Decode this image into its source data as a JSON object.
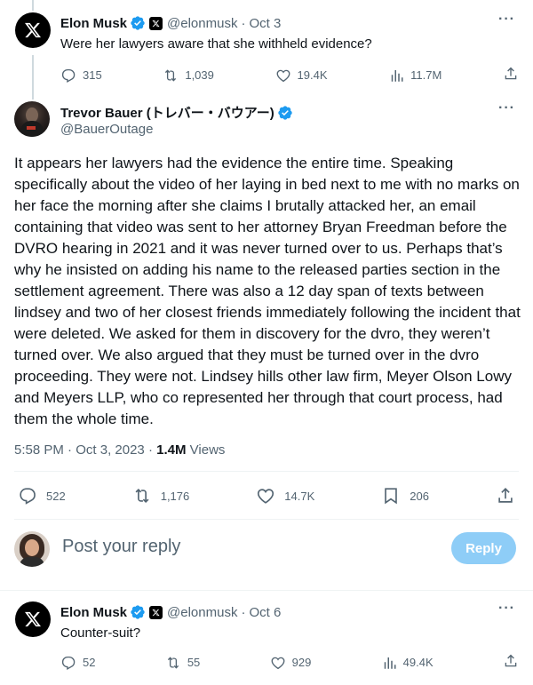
{
  "top_tweet": {
    "name": "Elon Musk",
    "handle": "@elonmusk",
    "date": "Oct 3",
    "text": "Were her lawyers aware that she withheld evidence?",
    "more_icon": "more-icon",
    "actions": {
      "replies": "315",
      "reposts": "1,039",
      "likes": "19.4K",
      "views": "11.7M"
    }
  },
  "main_tweet": {
    "name": "Trevor Bauer (トレバー・バウアー)",
    "handle": "@BauerOutage",
    "text": "It appears her lawyers had the evidence the entire time. Speaking specifically about the video of her laying in bed next to me with no marks on her face the morning after she claims I brutally attacked her, an email containing that video was sent to her attorney Bryan Freedman before the DVRO hearing in 2021 and it was never turned over to us. Perhaps that’s why he insisted on adding his name to the released parties section in the settlement agreement. There was also a 12 day span of texts between lindsey and two of her closest friends immediately following the incident that were deleted. We asked for them in discovery for the dvro, they weren’t turned over. We also argued that they must be turned over in the dvro proceeding. They were not. Lindsey hills other law firm, Meyer Olson Lowy and Meyers LLP, who co represented her through that court process, had them the whole time.",
    "time": "5:58 PM",
    "date": "Oct 3, 2023",
    "views_count": "1.4M",
    "views_label": "Views",
    "actions": {
      "replies": "522",
      "reposts": "1,176",
      "likes": "14.7K",
      "bookmarks": "206"
    }
  },
  "reply_box": {
    "placeholder": "Post your reply",
    "button_label": "Reply"
  },
  "bottom_tweet": {
    "name": "Elon Musk",
    "handle": "@elonmusk",
    "date": "Oct 6",
    "text": "Counter-suit?",
    "actions": {
      "replies": "52",
      "reposts": "55",
      "likes": "929",
      "views": "49.4K"
    }
  },
  "colors": {
    "verified_blue": "#1d9bf0",
    "secondary_text": "#536471",
    "reply_button_disabled": "#8ecdf7"
  }
}
